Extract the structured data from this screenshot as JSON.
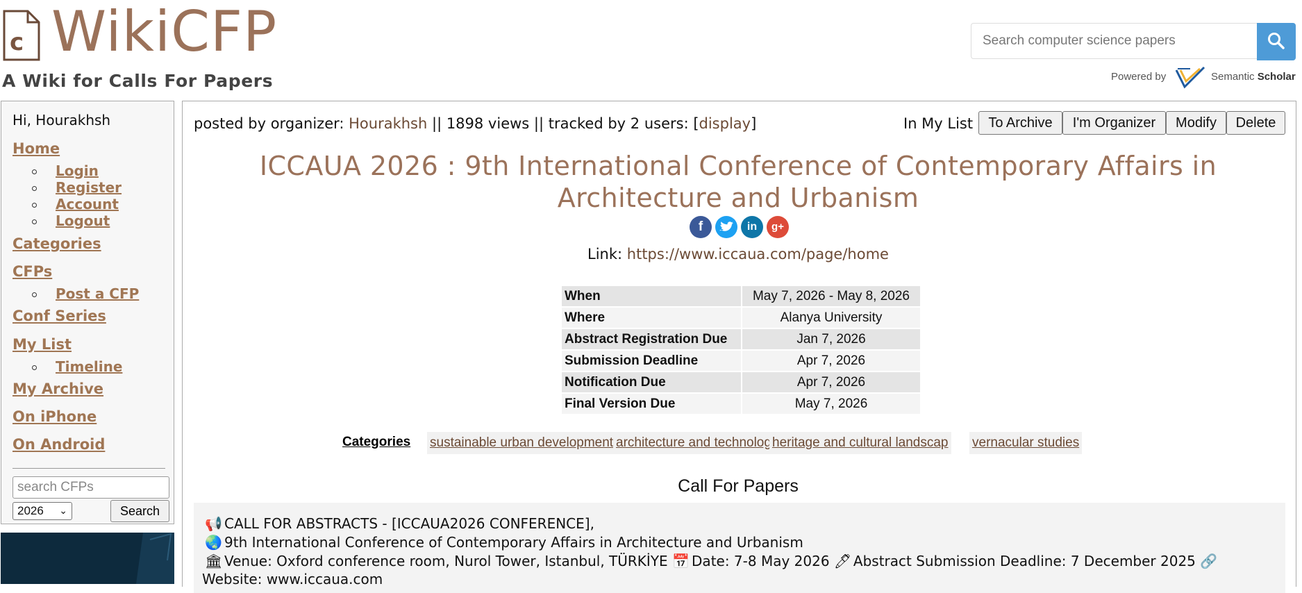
{
  "header": {
    "logo_text": "WikiCFP",
    "tagline": "A Wiki for Calls For Papers",
    "search_placeholder": "Search computer science papers",
    "powered_by": "Powered by",
    "ss_name_1": "Semantic",
    "ss_name_2": "Scholar"
  },
  "sidebar": {
    "greeting": "Hi, Hourakhsh",
    "home": "Home",
    "login": "Login",
    "register": "Register",
    "account": "Account",
    "logout": "Logout",
    "categories": "Categories",
    "cfps": "CFPs",
    "post_cfp": "Post a CFP",
    "conf_series": "Conf Series",
    "my_list": "My List",
    "timeline": "Timeline",
    "my_archive": "My Archive",
    "on_iphone": "On iPhone",
    "on_android": "On Android",
    "search_placeholder": "search CFPs",
    "year": "2026",
    "search_button": "Search"
  },
  "main": {
    "posted_prefix": "posted by organizer: ",
    "organizer": "Hourakhsh",
    "posted_mid": " || 1898 views || tracked by 2 users: [",
    "display_link": "display",
    "posted_suffix": "]",
    "in_my_list": "In My List",
    "btn_archive": "To Archive",
    "btn_organizer": "I'm Organizer",
    "btn_modify": "Modify",
    "btn_delete": "Delete",
    "title": "ICCAUA 2026 : 9th International Conference of Contemporary Affairs in Architecture and Urbanism",
    "link_label": "Link: ",
    "link_url": "https://www.iccaua.com/page/home",
    "info": [
      {
        "key": "When",
        "value": "May 7, 2026 - May 8, 2026"
      },
      {
        "key": "Where",
        "value": "Alanya University"
      },
      {
        "key": "Abstract Registration Due",
        "value": "Jan 7, 2026"
      },
      {
        "key": "Submission Deadline",
        "value": "Apr 7, 2026"
      },
      {
        "key": "Notification Due",
        "value": "Apr 7, 2026"
      },
      {
        "key": "Final Version Due",
        "value": "May 7, 2026"
      }
    ],
    "categories_label": "Categories",
    "categories": [
      "sustainable urban development",
      "architecture and technology",
      "heritage and cultural landscap",
      "vernacular studies"
    ],
    "cfp_heading": "Call For Papers",
    "cfp_lines": [
      "CALL FOR ABSTRACTS - [ICCAUA2026 CONFERENCE],",
      "9th International Conference of Contemporary Affairs in Architecture and Urbanism",
      "Venue: Oxford conference room, Nurol Tower, Istanbul, TÜRKİYE",
      "Date: 7-8 May 2026",
      "Abstract Submission Deadline: 7 December 2025",
      "Website: www.iccaua.com"
    ]
  }
}
